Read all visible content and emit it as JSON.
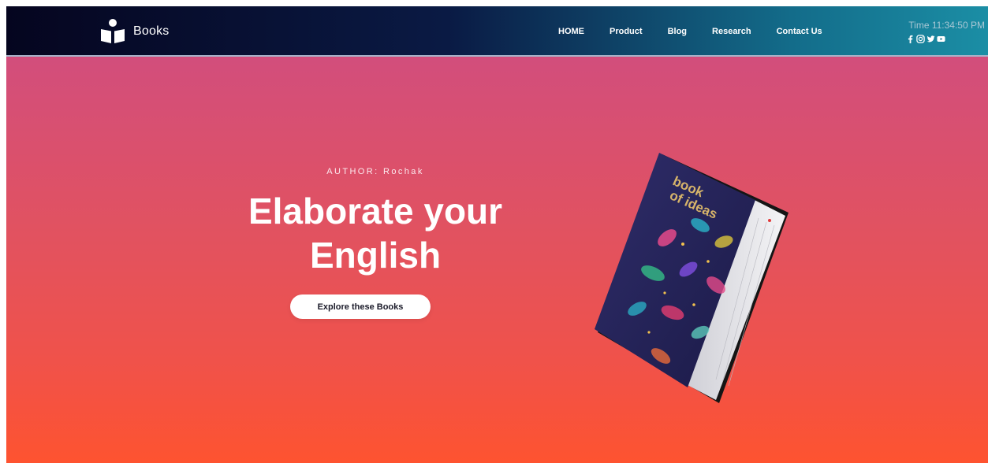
{
  "header": {
    "brand_name": "Books",
    "nav_items": [
      "HOME",
      "Product",
      "Blog",
      "Research",
      "Contact Us"
    ],
    "clock_text": "Time 11:34:50 PM",
    "social_icons": [
      "facebook-icon",
      "instagram-icon",
      "twitter-icon",
      "youtube-icon"
    ]
  },
  "hero": {
    "author_label": "AUTHOR: Rochak",
    "headline_line1": "Elaborate your",
    "headline_line2": "English",
    "cta_label": "Explore these Books",
    "book_title_line1": "book",
    "book_title_line2": "of ideas"
  },
  "colors": {
    "nav_dark": "#05051f",
    "nav_teal": "#1b8ea5",
    "hero_top": "#d24e7c",
    "hero_bottom": "#fe5330",
    "book_cover": "#2a2860"
  }
}
